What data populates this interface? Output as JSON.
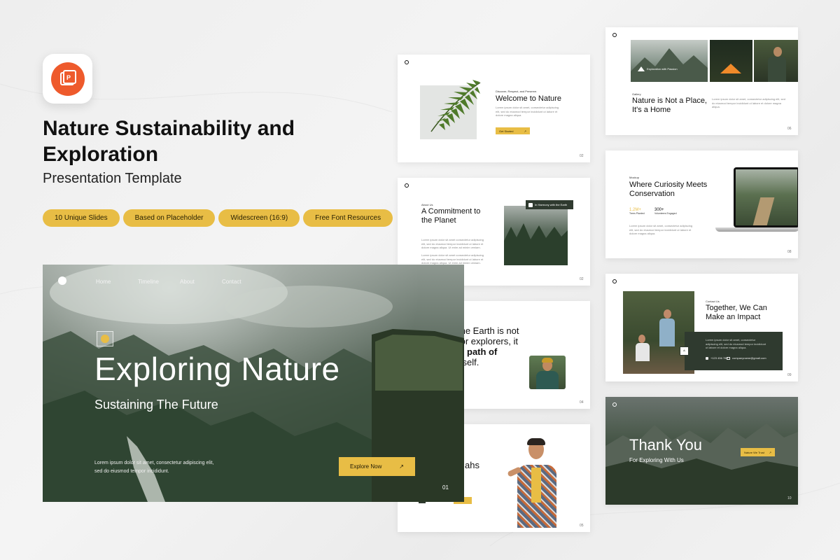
{
  "hero_text": {
    "title": "Nature Sustainability and Exploration",
    "subtitle": "Presentation Template"
  },
  "pills": [
    "10 Unique Slides",
    "Based on Placeholder",
    "Widescreen (16:9)",
    "Free Font Resources"
  ],
  "hero_slide": {
    "nav": [
      "Home",
      "Timeline",
      "About",
      "Contact"
    ],
    "title": "Exploring Nature",
    "subtitle": "Sustaining The Future",
    "body": "Lorem ipsum dolor sit amet, consectetur adipiscing elit, sed do eiusmod tempor incididunt.",
    "button": "Explore Now",
    "page": "01"
  },
  "slide_welcome": {
    "eyebrow": "Discover, Respect, and Preserve.",
    "title": "Welcome to Nature",
    "body": "Lorem ipsum dolor sit amet, consectetur adipiscing elit, sed do eiusmod tempor incididunt ut labore et dolore magna aliqua.",
    "button": "Get Started",
    "page": "02"
  },
  "slide_about": {
    "eyebrow": "About Us",
    "title": "A Commitment to the Planet",
    "badge": "In Harmony with the Earth",
    "body": "Lorem ipsum dolor sit amet consectetur adipiscing elit, sed do eiusmod tempor incididunt ut labore et dolore magna aliqua. Ut enim ad minim veniam.",
    "page": "02"
  },
  "slide_quote": {
    "line1": "the Earth is not",
    "line2": "for explorers, it",
    "line3": "path of",
    "line4": "itself.",
    "page": "04"
  },
  "slide_team": {
    "title": "ahs",
    "page": "05"
  },
  "slide_gallery": {
    "eyebrow": "Gallery",
    "title": "Nature is Not a Place, It's a Home",
    "caption": "Exploration with Passion",
    "body": "Lorem ipsum dolor sit amet, consectetur adipiscing elit, sed do eiusmod tempor incididunt ut labore et dolore magna aliqua.",
    "page": "06"
  },
  "slide_mockup": {
    "eyebrow": "Mockup",
    "title": "Where Curiosity Meets Conservation",
    "stat1_value": "1.2M+",
    "stat1_label": "Trees Planted",
    "stat2_value": "300+",
    "stat2_label": "Volunteers Engaged",
    "body": "Lorem ipsum dolor sit amet, consectetur adipiscing elit, sed do eiusmod tempor incididunt ut labore et dolore magna aliqua.",
    "page": "08"
  },
  "slide_contact": {
    "eyebrow": "Contact Us",
    "title": "Together, We Can Make an Impact",
    "body": "Lorem ipsum dolor sit amet, consectetur adipiscing elit, sed do eiusmod tempor incididunt ut labore et dolore magna aliqua.",
    "phone": "+123 456 789",
    "email": "companyname@gmail.com",
    "page": "09"
  },
  "slide_thanks": {
    "title": "Thank You",
    "subtitle": "For Exploring With Us",
    "button": "Nature We Trust",
    "page": "10"
  },
  "colors": {
    "accent": "#e8bd45",
    "brand_icon": "#ee5a2c",
    "dark_green": "#2f3a2f"
  },
  "icons": [
    "powerpoint-icon",
    "leaf-icon",
    "arrow-up-right-icon",
    "mountain-icon",
    "phone-icon",
    "mail-icon",
    "logo-icon"
  ]
}
